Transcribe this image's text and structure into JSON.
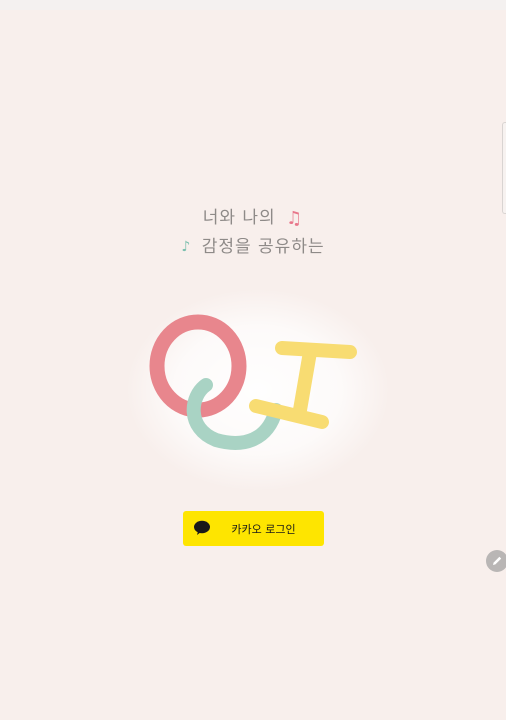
{
  "tagline": {
    "line1": "너와 나의",
    "line2": "감정을 공유하는",
    "note_icon_1": "music-note-icon",
    "note_icon_2": "music-note-icon"
  },
  "logo": {
    "name": "QJ",
    "colors": {
      "ring": "#e8868d",
      "u_shape": "#a9d3c4",
      "i_shape": "#f8dc72"
    }
  },
  "login": {
    "label": "카카오 로그인",
    "icon": "speech-bubble-icon",
    "color": "#fee500"
  },
  "fab": {
    "icon": "pencil-icon"
  },
  "colors": {
    "background": "#f8efec",
    "text": "#8e8a88"
  }
}
